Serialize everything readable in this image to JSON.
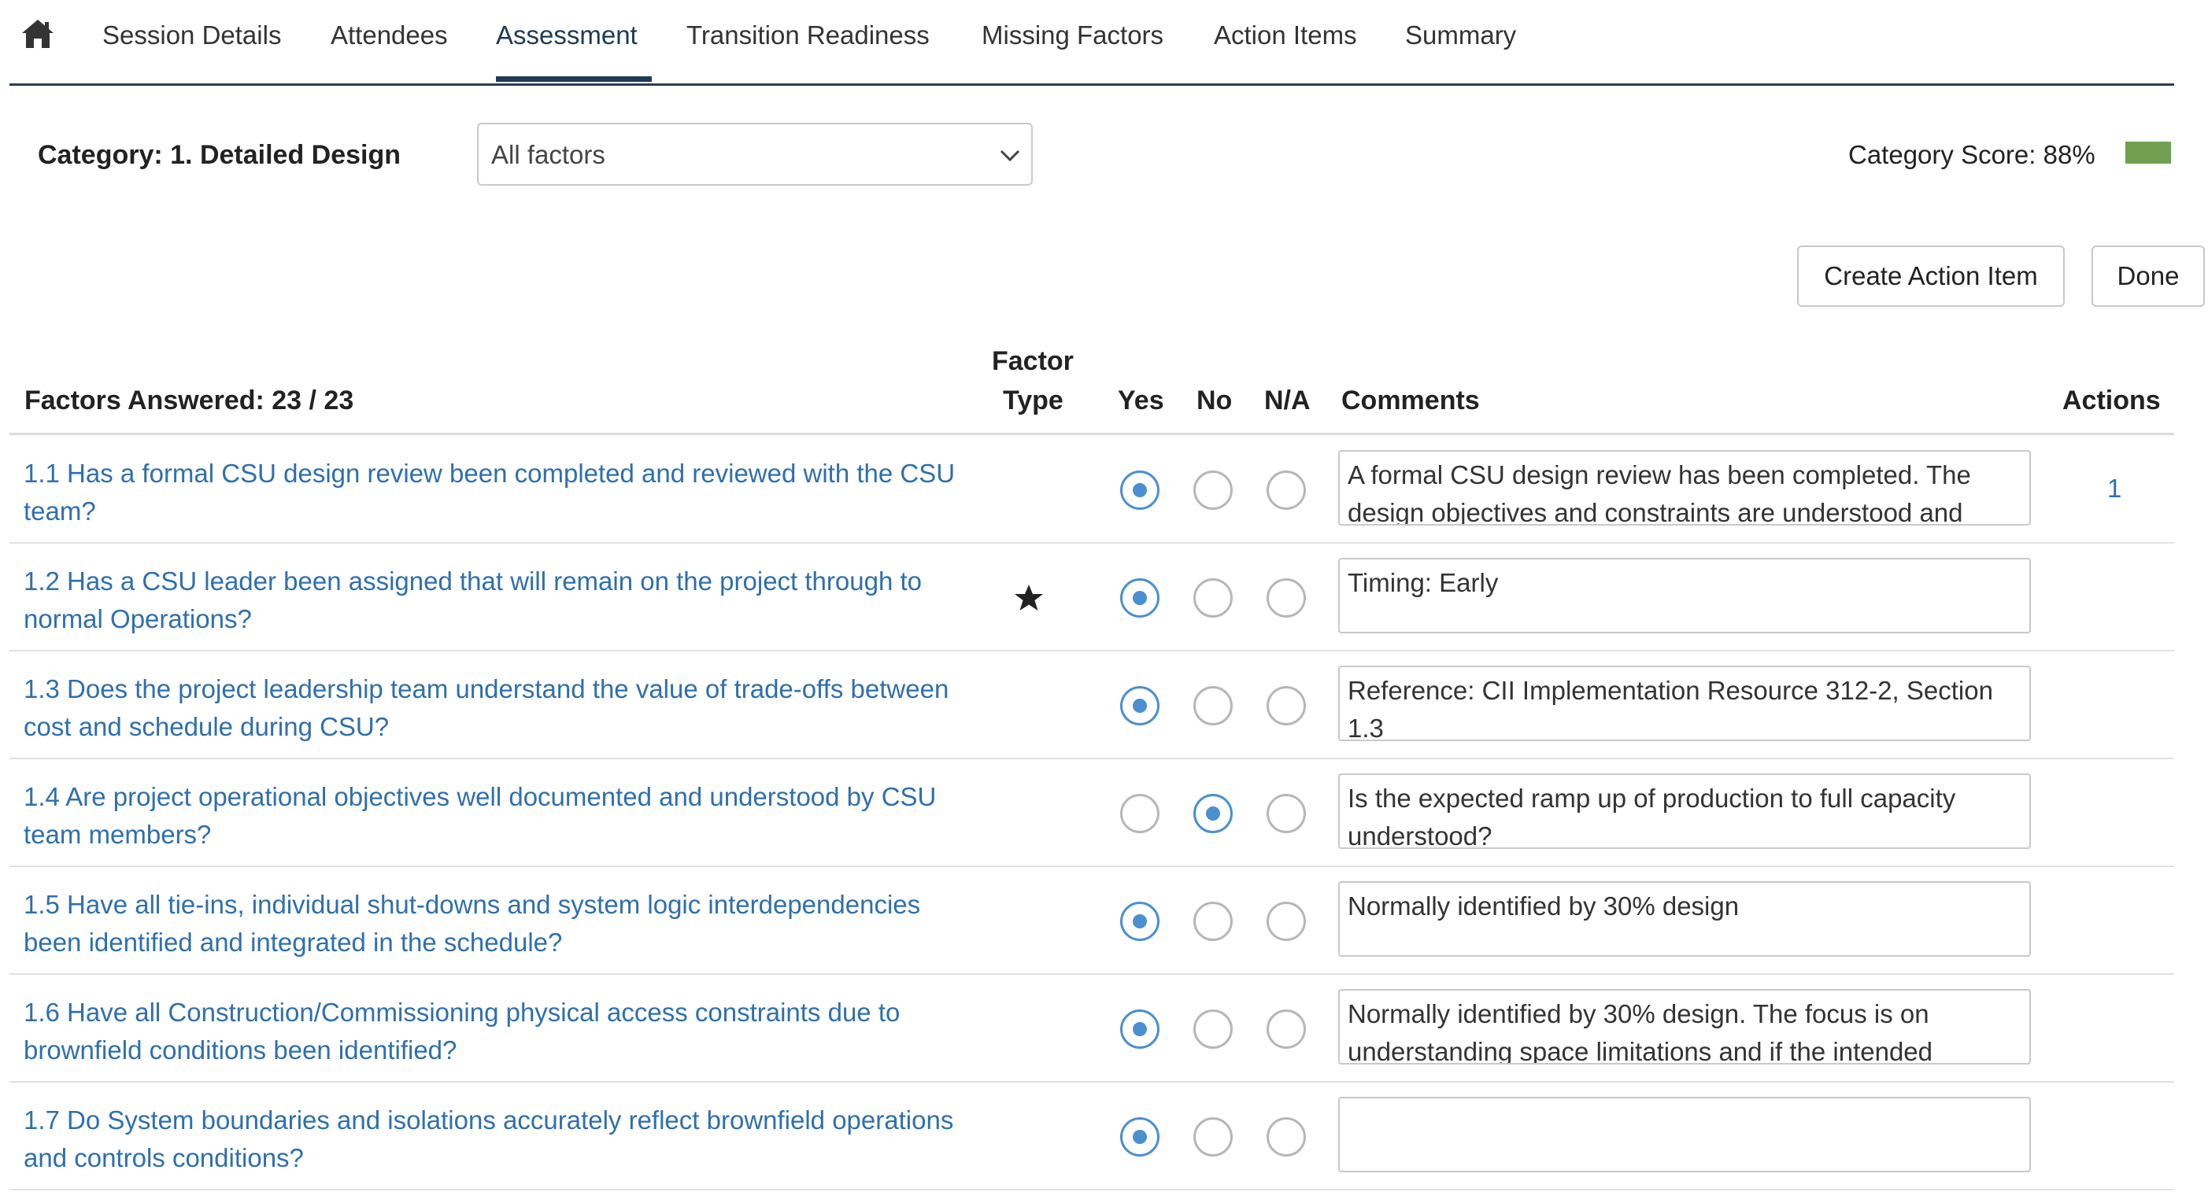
{
  "nav": {
    "home_icon": "home-icon",
    "tabs": [
      {
        "label": "Session Details"
      },
      {
        "label": "Attendees"
      },
      {
        "label": "Assessment"
      },
      {
        "label": "Transition Readiness"
      },
      {
        "label": "Missing Factors"
      },
      {
        "label": "Action Items"
      },
      {
        "label": "Summary"
      }
    ],
    "active_tab": "Assessment"
  },
  "category": {
    "label": "Category: 1. Detailed Design",
    "filter_selected": "All factors",
    "score_label": "Category Score: 88%",
    "score_color": "#70a050"
  },
  "buttons": {
    "create_action_item": "Create Action Item",
    "done": "Done"
  },
  "table": {
    "headers": {
      "factors_answered": "Factors Answered: 23 / 23",
      "factor_type_line1": "Factor",
      "factor_type_line2": "Type",
      "yes": "Yes",
      "no": "No",
      "na": "N/A",
      "comments": "Comments",
      "actions": "Actions"
    },
    "rows": [
      {
        "question": "1.1 Has a formal CSU design review been completed and reviewed with the CSU team?",
        "answer": "yes",
        "star": false,
        "comment": "A formal CSU design review has been completed. The design objectives and constraints are understood and",
        "actions": "1"
      },
      {
        "question": "1.2 Has a CSU leader been assigned that will remain on the project through to normal Operations?",
        "answer": "yes",
        "star": true,
        "comment": "Timing: Early",
        "actions": ""
      },
      {
        "question": "1.3 Does the project leadership team understand the value of trade-offs between cost and schedule during CSU?",
        "answer": "yes",
        "star": false,
        "comment": "Reference: CII Implementation Resource 312-2, Section 1.3",
        "actions": ""
      },
      {
        "question": "1.4 Are project operational objectives well documented and understood by CSU team members?",
        "answer": "no",
        "star": false,
        "comment": "Is the expected ramp up of production to full capacity understood?",
        "actions": ""
      },
      {
        "question": "1.5 Have all tie-ins, individual shut-downs and system logic interdependencies been identified and integrated in the schedule?",
        "answer": "yes",
        "star": false,
        "comment": "Normally identified by 30% design",
        "actions": ""
      },
      {
        "question": "1.6 Have all Construction/Commissioning physical access constraints due to brownfield conditions been identified?",
        "answer": "yes",
        "star": false,
        "comment": "Normally identified by 30% design. The focus is on understanding space limitations and if the intended",
        "actions": ""
      },
      {
        "question": "1.7 Do System boundaries and isolations accurately reflect brownfield operations and controls conditions?",
        "answer": "yes",
        "star": false,
        "comment": "",
        "actions": ""
      }
    ]
  }
}
